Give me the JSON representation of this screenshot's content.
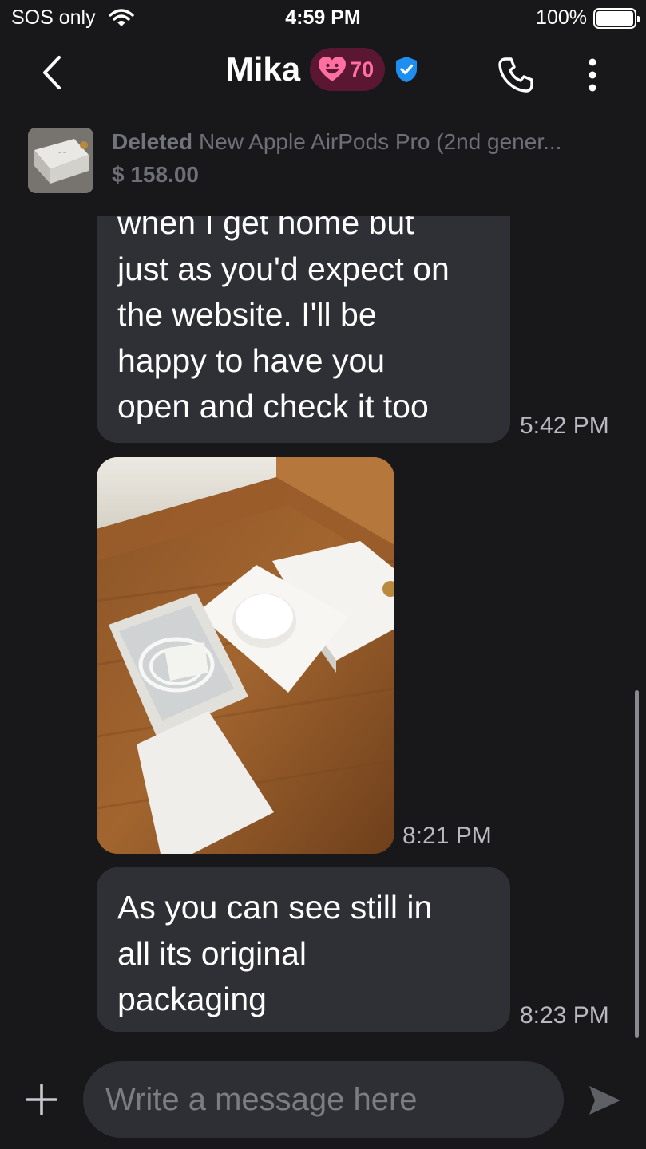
{
  "status_bar": {
    "carrier": "SOS only",
    "time": "4:59 PM",
    "battery": "100%"
  },
  "header": {
    "contact_name": "Mika",
    "heart_score": "70",
    "verified": true
  },
  "listing": {
    "status": "Deleted",
    "title": "New Apple AirPods Pro (2nd gener...",
    "price": "$ 158.00"
  },
  "messages": [
    {
      "type": "text",
      "lines": [
        "when I get home but",
        "just as you'd expect on",
        "the website. I'll be",
        "happy to have you",
        "open and check it too"
      ],
      "time": "5:42 PM"
    },
    {
      "type": "image",
      "alt": "",
      "time": "8:21 PM"
    },
    {
      "type": "text",
      "lines": [
        "As you can see still in",
        "all its original",
        "packaging"
      ],
      "time": "8:23 PM"
    }
  ],
  "composer": {
    "placeholder": "Write a message here"
  },
  "icons": {
    "back": "chevron-left-icon",
    "heart": "heart-icon",
    "verified": "verified-badge-icon",
    "call": "phone-icon",
    "more": "more-vertical-icon",
    "plus": "plus-icon",
    "send": "send-icon",
    "wifi": "wifi-icon",
    "battery": "battery-icon"
  },
  "colors": {
    "background": "#18181b",
    "bubble": "#2f3035",
    "heart_badge_bg": "#5b1631",
    "heart_accent": "#ff6fa0",
    "verified_blue": "#1d8ff0"
  }
}
